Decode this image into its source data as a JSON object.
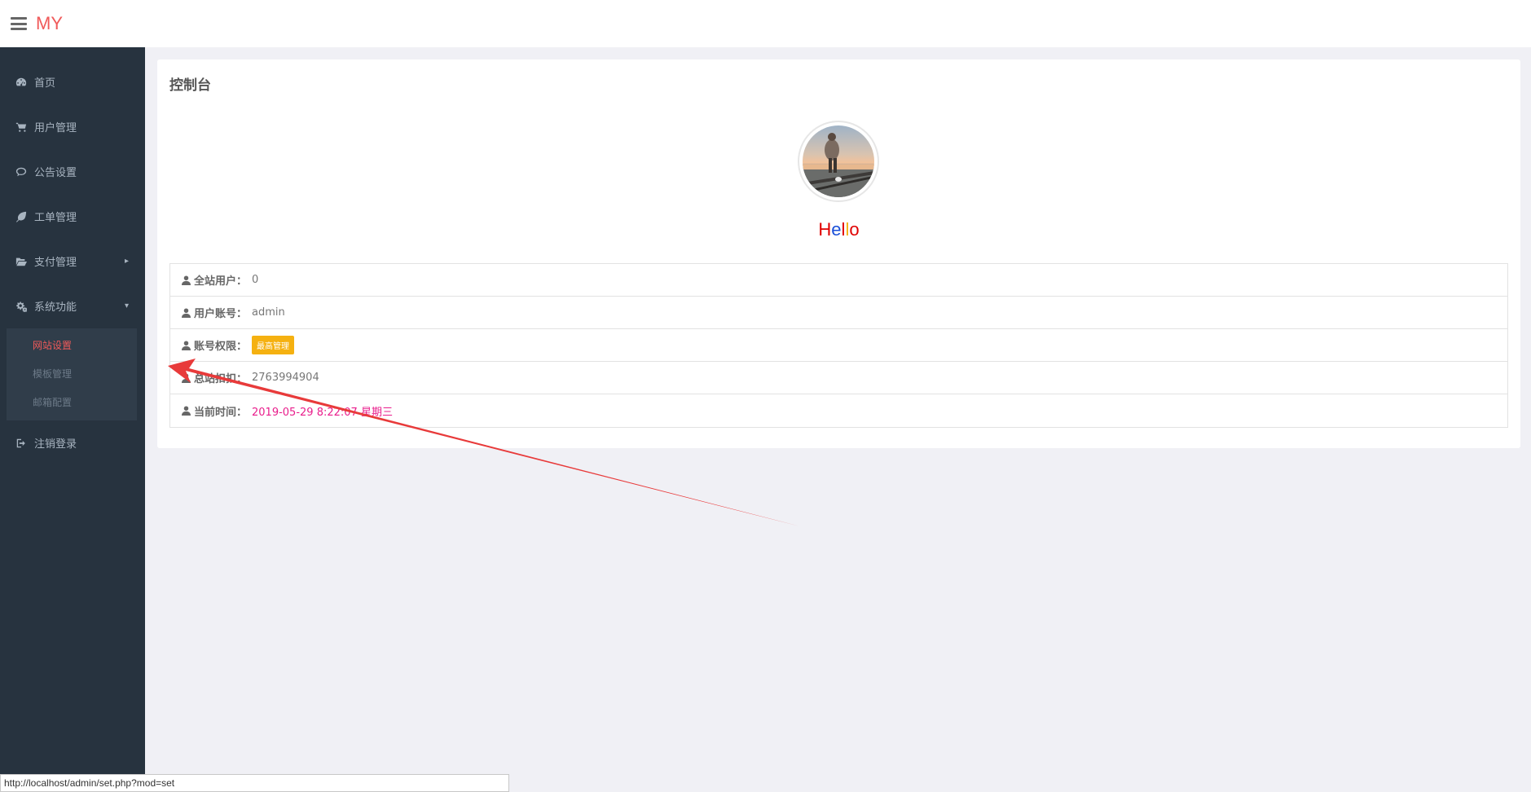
{
  "header": {
    "brand": "MY",
    "menu_icon": "hamburger-icon"
  },
  "sidebar": {
    "items": [
      {
        "label": "首页",
        "icon": "dashboard-icon"
      },
      {
        "label": "用户管理",
        "icon": "cart-icon"
      },
      {
        "label": "公告设置",
        "icon": "comment-icon"
      },
      {
        "label": "工单管理",
        "icon": "leaf-icon"
      },
      {
        "label": "支付管理",
        "icon": "folder-open-icon",
        "arrow": "▸"
      },
      {
        "label": "系统功能",
        "icon": "cogs-icon",
        "arrow": "▾"
      },
      {
        "label": "注销登录",
        "icon": "sign-out-icon"
      }
    ],
    "submenu": [
      {
        "label": "网站设置",
        "active": true
      },
      {
        "label": "模板管理"
      },
      {
        "label": "邮箱配置"
      }
    ]
  },
  "main": {
    "title": "控制台",
    "hello": [
      "H",
      "e",
      "l",
      "l",
      "o"
    ],
    "hello_colors": [
      "#e00000",
      "#1a4fd8",
      "#e00000",
      "#f5b111",
      "#e00000"
    ],
    "rows": [
      {
        "label": "全站用户：",
        "value": "0"
      },
      {
        "label": "用户账号：",
        "value": "admin"
      },
      {
        "label": "账号权限：",
        "badge": "最高管理"
      },
      {
        "label": "总站扣扣：",
        "value": "2763994904"
      },
      {
        "label": "当前时间：",
        "value": "2019-05-29 8:22:07 星期三"
      }
    ]
  },
  "statusbar": {
    "url": "http://localhost/admin/set.php?mod=set"
  },
  "colors": {
    "accent": "#f05a5a",
    "sidebar_bg": "#27333f",
    "badge": "#f5b111",
    "time": "#e91e8c",
    "arrow": "#e83a3a"
  }
}
